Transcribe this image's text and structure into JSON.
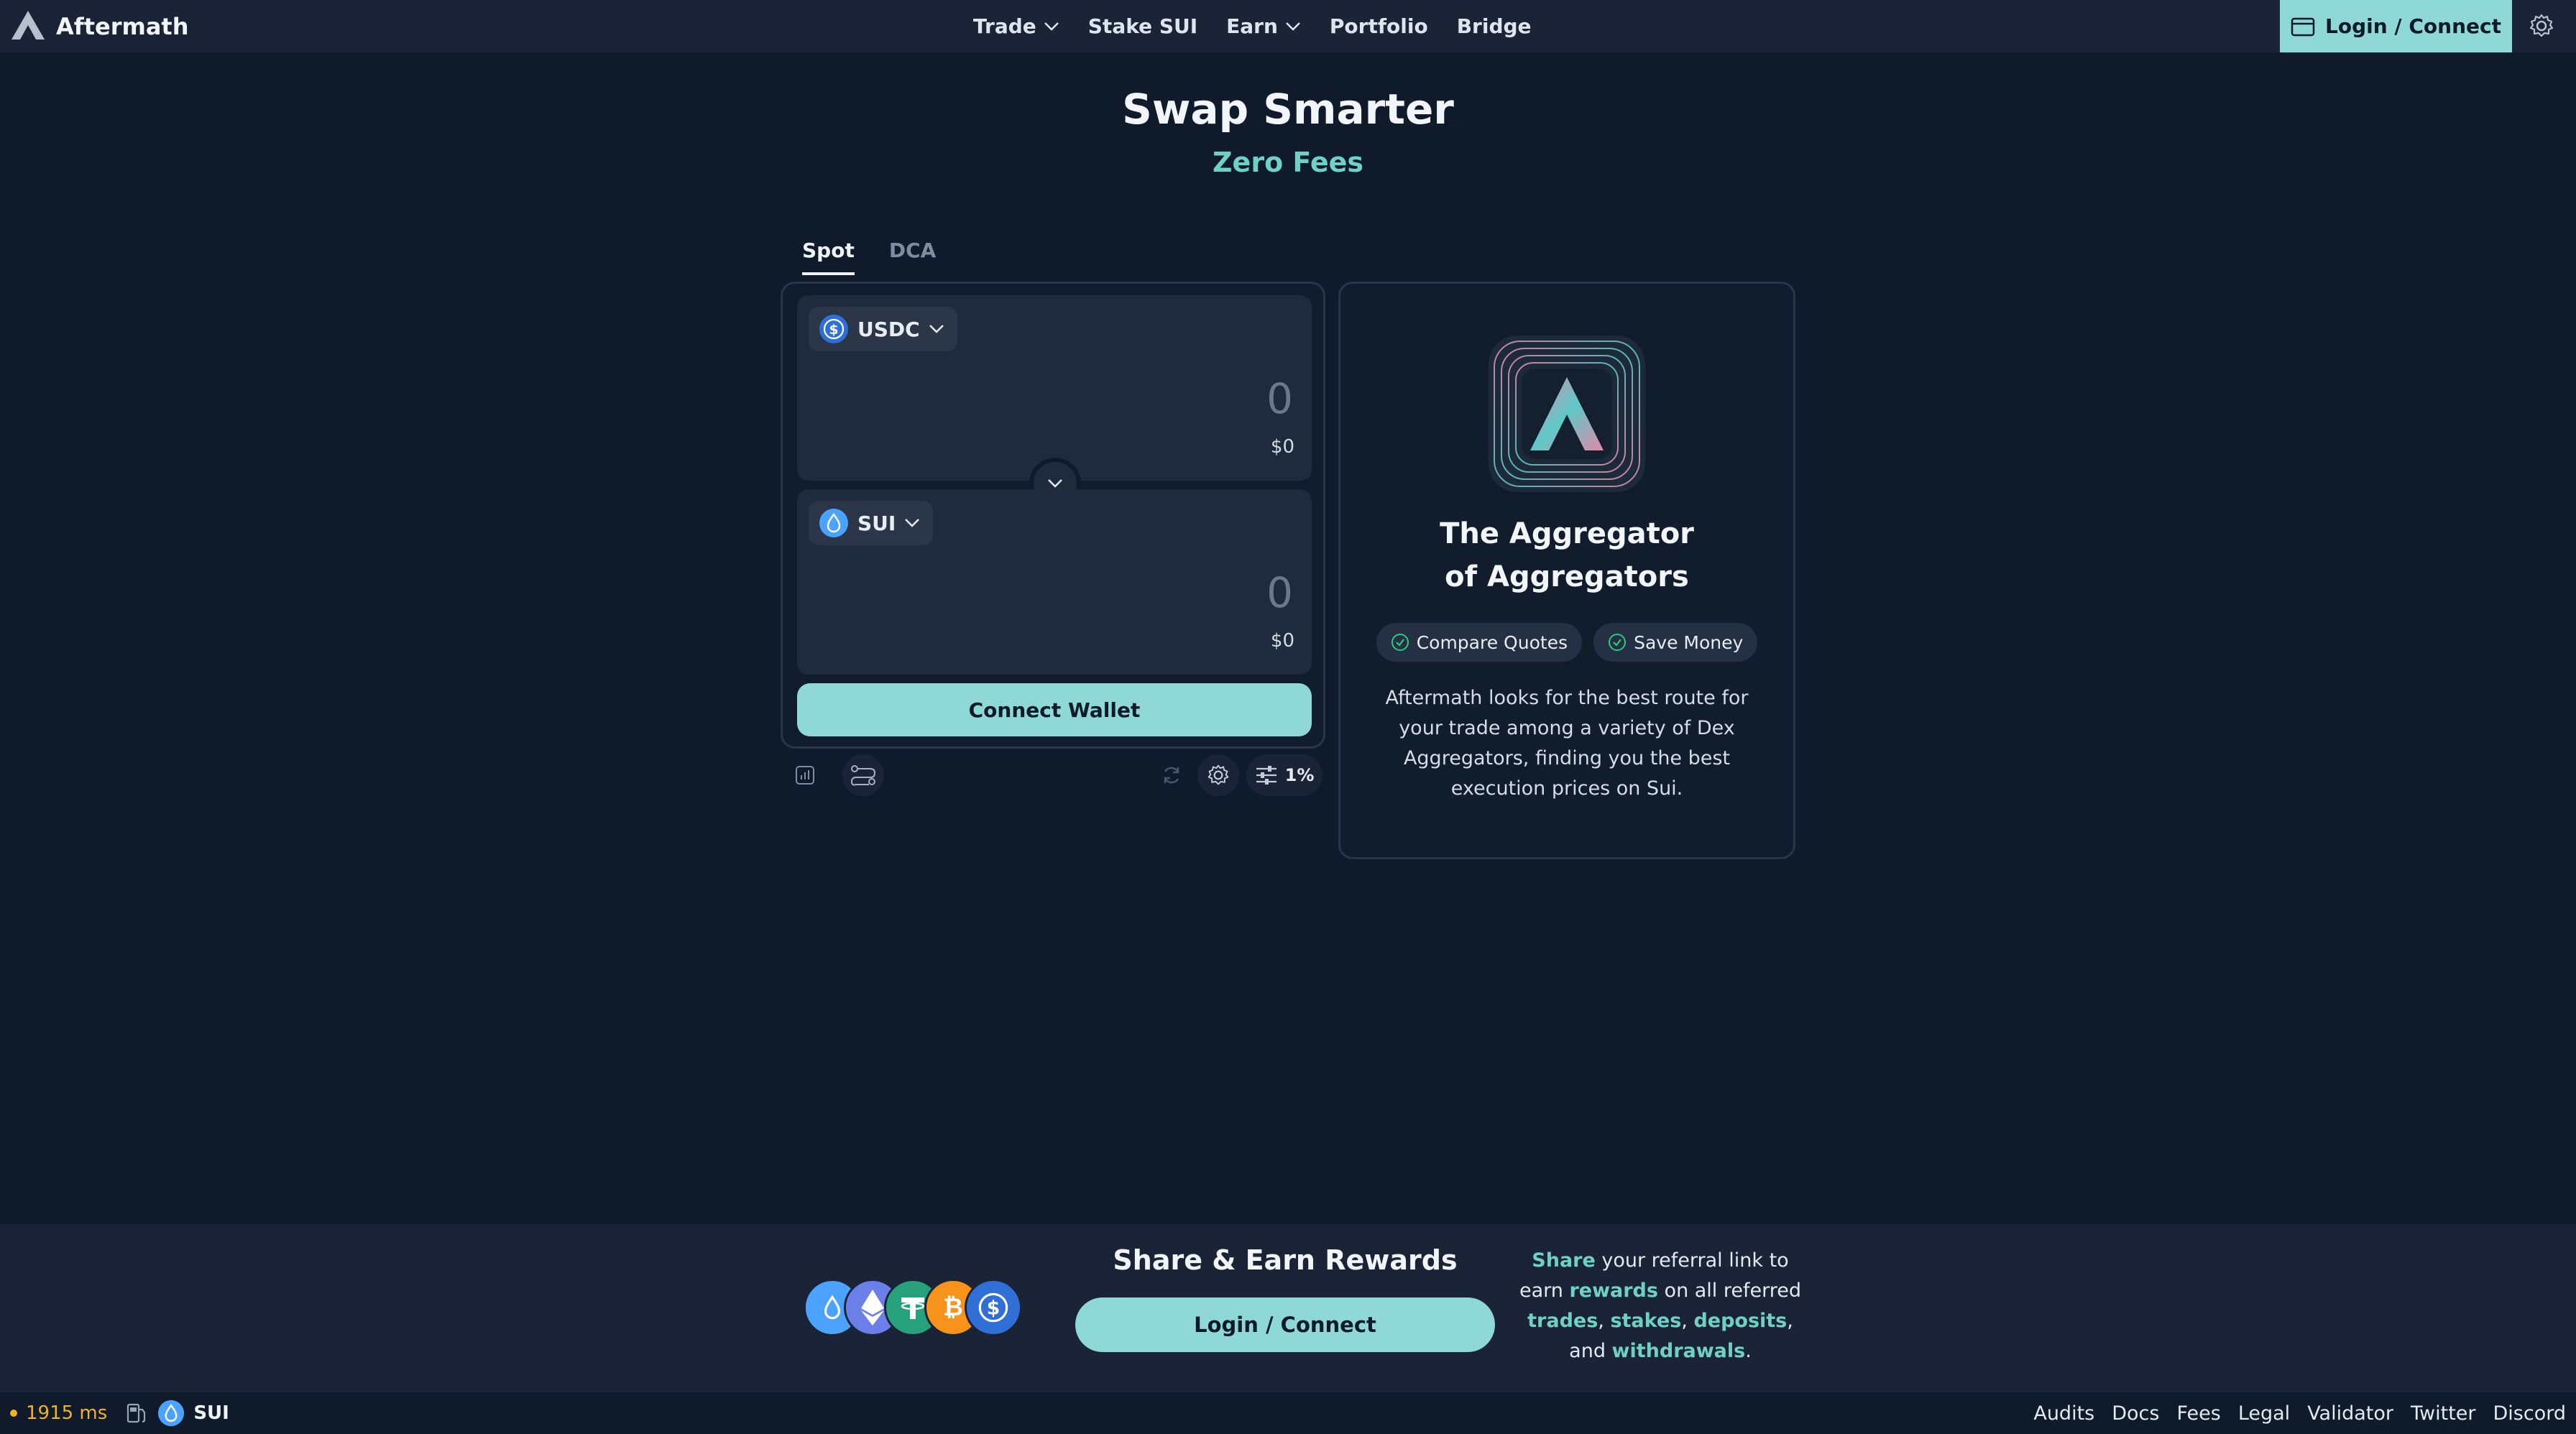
{
  "header": {
    "brand": "Aftermath",
    "nav": [
      {
        "label": "Trade",
        "dropdown": true
      },
      {
        "label": "Stake SUI",
        "dropdown": false
      },
      {
        "label": "Earn",
        "dropdown": true
      },
      {
        "label": "Portfolio",
        "dropdown": false
      },
      {
        "label": "Bridge",
        "dropdown": false
      }
    ],
    "login_label": "Login / Connect"
  },
  "hero": {
    "title": "Swap Smarter",
    "subtitle": "Zero Fees"
  },
  "swap": {
    "tabs": [
      {
        "label": "Spot",
        "active": true
      },
      {
        "label": "DCA",
        "active": false
      }
    ],
    "from": {
      "token": "USDC",
      "amount": "0",
      "usd": "$0",
      "icon": "usdc-icon"
    },
    "to": {
      "token": "SUI",
      "amount": "0",
      "usd": "$0",
      "icon": "sui-icon"
    },
    "connect_label": "Connect Wallet",
    "slippage": "1%"
  },
  "info": {
    "title": "The Aggregator of Aggregators",
    "chips": [
      "Compare Quotes",
      "Save Money"
    ],
    "description": "Aftermath looks for the best route for your trade among a variety of Dex Aggregators, finding you the best execution prices on Sui."
  },
  "referral": {
    "title": "Share & Earn Rewards",
    "login_label": "Login / Connect",
    "text": {
      "w_share": "Share",
      "t1": " your referral link to earn ",
      "w_rewards": "rewards",
      "t2": " on all referred ",
      "w_trades": "trades",
      "t3": ", ",
      "w_stakes": "stakes",
      "t4": ", ",
      "w_deposits": "deposits",
      "t5": ", and ",
      "w_withdrawals": "withdrawals",
      "t6": "."
    }
  },
  "status": {
    "latency": "1915 ms",
    "network_token": "SUI"
  },
  "footer_links": [
    "Audits",
    "Docs",
    "Fees",
    "Legal",
    "Validator",
    "Twitter",
    "Discord"
  ],
  "colors": {
    "accent": "#8ed8d8",
    "accent_text": "#6fd0c8",
    "background": "#0f1a2b",
    "panel": "#1a2436",
    "latency": "#f3b12a"
  }
}
